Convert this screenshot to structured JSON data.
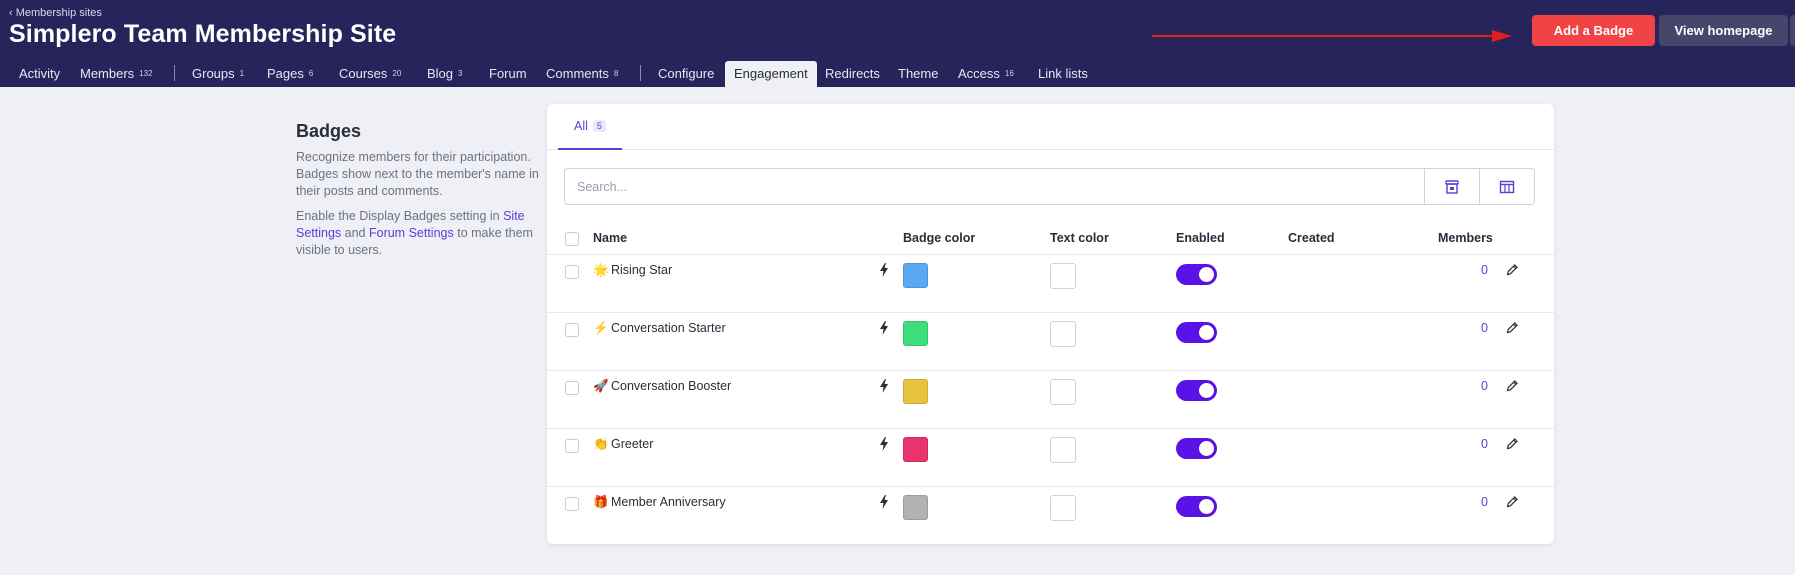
{
  "header": {
    "back_link": "‹ Membership sites",
    "title": "Simplero Team Membership Site",
    "add_badge": "Add a Badge",
    "view_homepage": "View homepage",
    "arrow_color": "#e02020"
  },
  "nav": [
    {
      "label": "Activity",
      "count": ""
    },
    {
      "label": "Members",
      "count": "132"
    },
    {
      "label": "Groups",
      "count": "1"
    },
    {
      "label": "Pages",
      "count": "6"
    },
    {
      "label": "Courses",
      "count": "20"
    },
    {
      "label": "Blog",
      "count": "3"
    },
    {
      "label": "Forum",
      "count": ""
    },
    {
      "label": "Comments",
      "count": "8"
    },
    {
      "label": "Configure",
      "count": ""
    },
    {
      "label": "Engagement",
      "count": "",
      "active": true
    },
    {
      "label": "Redirects",
      "count": ""
    },
    {
      "label": "Theme",
      "count": ""
    },
    {
      "label": "Access",
      "count": "16"
    },
    {
      "label": "Link lists",
      "count": ""
    }
  ],
  "sidebar": {
    "title": "Badges",
    "description": "Recognize members for their participation. Badges show next to the member's name in their posts and comments.",
    "enable_prefix": "Enable the Display Badges setting in ",
    "link_site_settings": "Site Settings",
    "and": " and ",
    "link_forum_settings": "Forum Settings",
    "enable_suffix": " to make them visible to users."
  },
  "tabs": {
    "all_label": "All",
    "all_count": "5"
  },
  "search": {
    "placeholder": "Search...",
    "value": ""
  },
  "table": {
    "headers": {
      "name": "Name",
      "badge_color": "Badge color",
      "text_color": "Text color",
      "enabled": "Enabled",
      "created": "Created",
      "members": "Members"
    },
    "rows": [
      {
        "emoji": "🌟",
        "name": "Rising Star",
        "badge_color": "#5aa9f2",
        "enabled": true,
        "created": "",
        "members": "0"
      },
      {
        "emoji": "⚡",
        "name": "Conversation Starter",
        "badge_color": "#3dde79",
        "enabled": true,
        "created": "",
        "members": "0"
      },
      {
        "emoji": "🚀",
        "name": "Conversation Booster",
        "badge_color": "#e8c33e",
        "enabled": true,
        "created": "",
        "members": "0"
      },
      {
        "emoji": "👏",
        "name": "Greeter",
        "badge_color": "#e8336d",
        "enabled": true,
        "created": "",
        "members": "0"
      },
      {
        "emoji": "🎁",
        "name": "Member Anniversary",
        "badge_color": "#b2b2b2",
        "enabled": true,
        "created": "",
        "members": "0"
      }
    ]
  },
  "colors": {
    "header_bg": "#27245c",
    "accent": "#5a3fd6",
    "toggle_on": "#5b12e6",
    "add_button": "#f04343",
    "view_button": "#46456b"
  }
}
